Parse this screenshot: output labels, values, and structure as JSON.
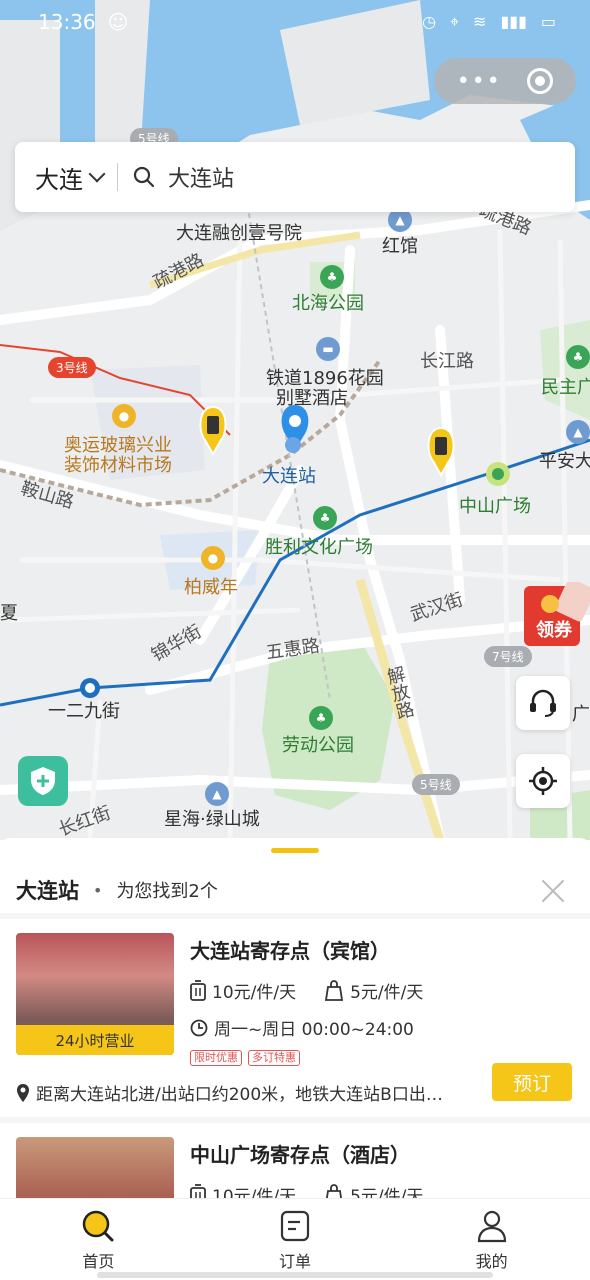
{
  "status_bar": {
    "time": "13:36"
  },
  "search": {
    "city": "大连",
    "query": "大连站"
  },
  "map": {
    "labels": {
      "rongchuang": "大连融创壹号院",
      "hongguan": "红馆",
      "shugang_road": "疏港路",
      "beihai_park": "北海公园",
      "line3": "3号线",
      "line5_top": "5号线",
      "line5_bottom": "5号线",
      "line7": "7号线",
      "railway_hotel_1": "铁道1896花园",
      "railway_hotel_2": "别墅酒店",
      "changjiang_road": "长江路",
      "minzhu": "民主广",
      "pingan": "平安大",
      "aoyun_1": "奥运玻璃兴业",
      "aoyun_2": "装饰材料市场",
      "dalian_station": "大连站",
      "zhongshan_square": "中山广场",
      "anshan_road": "鞍山路",
      "shengli": "胜利文化广场",
      "baiweinian": "柏威年",
      "wuhan_street": "武汉街",
      "jinhua_street": "锦华街",
      "wuhui_road": "五惠路",
      "jiefang_road": "解放路",
      "yierjiu_street": "一二九街",
      "laodong_park": "劳动公园",
      "xinghai": "星海·绿山城",
      "shugang_top": "疏港路",
      "xia": "夏",
      "guang": "广",
      "changhong": "长红街",
      "coupon": "领券"
    }
  },
  "sheet": {
    "title": "大连站",
    "found_text": "为您找到2个",
    "items": [
      {
        "name": "大连站寄存点（宾馆）",
        "badge": "24小时营业",
        "price_luggage": "10元/件/天",
        "price_bag": "5元/件/天",
        "hours": "周一~周日 00:00~24:00",
        "tags": [
          "限时优惠",
          "多订特惠"
        ],
        "address": "距离大连站北进/出站口约200米，地铁大连站B口出…",
        "book_label": "预订"
      },
      {
        "name": "中山广场寄存点（酒店）",
        "price_luggage": "10元/件/天",
        "price_bag": "5元/件/天"
      }
    ]
  },
  "tabbar": {
    "home": "首页",
    "orders": "订单",
    "mine": "我的"
  },
  "colors": {
    "accent": "#f5c518",
    "metro_line": "#1f6fc0",
    "line3": "#e5452f",
    "park": "#cfe8c6",
    "water": "#8cc4ee"
  }
}
